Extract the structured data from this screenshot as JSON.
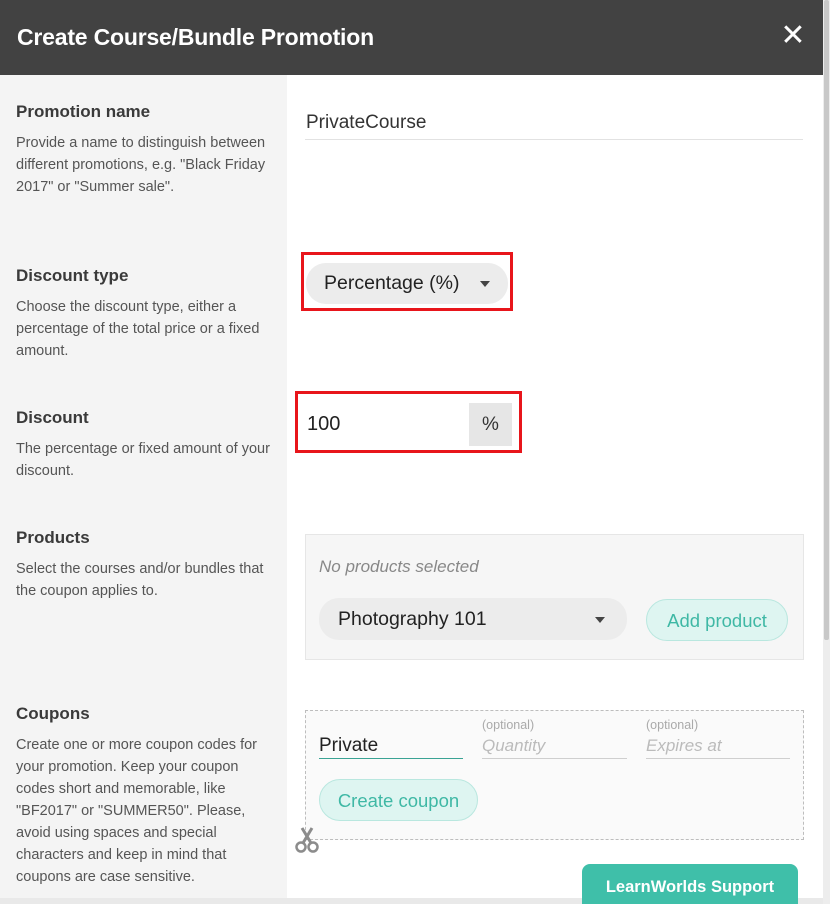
{
  "dialog": {
    "title": "Create Course/Bundle Promotion",
    "close_icon": "close-icon"
  },
  "promotion_name": {
    "title": "Promotion name",
    "description": "Provide a name to distinguish between different promotions, e.g. \"Black Friday 2017\" or \"Summer sale\".",
    "value": "PrivateCourse"
  },
  "discount_type": {
    "title": "Discount type",
    "description": "Choose the discount type, either a percentage of the total price or a fixed amount.",
    "selected": "Percentage (%)"
  },
  "discount": {
    "title": "Discount",
    "description": "The percentage or fixed amount of your discount.",
    "value": "100",
    "unit": "%"
  },
  "products": {
    "title": "Products",
    "description": "Select the courses and/or bundles that the coupon applies to.",
    "empty_text": "No products selected",
    "selected_product": "Photography 101",
    "add_button": "Add product"
  },
  "coupons": {
    "title": "Coupons",
    "description": "Create one or more coupon codes for your promotion. Keep your coupon codes short and memorable, like \"BF2017\" or \"SUMMER50\". Please, avoid using spaces and special characters and keep in mind that coupons are case sensitive.",
    "code_value": "Private",
    "quantity_label": "(optional)",
    "quantity_placeholder": "Quantity",
    "expires_label": "(optional)",
    "expires_placeholder": "Expires at",
    "create_button": "Create coupon"
  },
  "support": {
    "label": "LearnWorlds Support"
  },
  "colors": {
    "header_bg": "#424242",
    "accent_teal": "#3fbfa9",
    "highlight_red": "#e8151b"
  }
}
